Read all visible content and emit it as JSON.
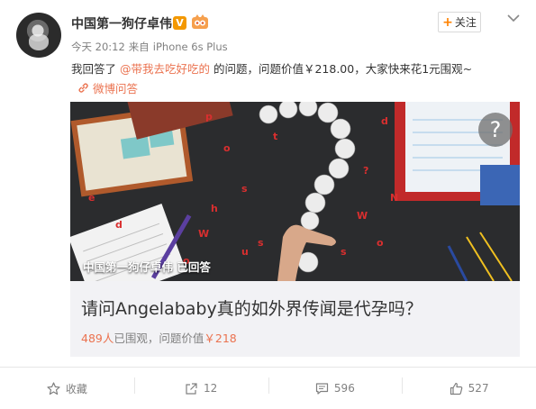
{
  "user": {
    "name": "中国第一狗仔卓伟",
    "vip_badge": "V",
    "follow_label": "关注"
  },
  "post": {
    "time": "今天 20:12",
    "source_prefix": "来自",
    "source": "iPhone 6s Plus",
    "text_before": "我回答了 ",
    "mention": "@带我去吃好吃的",
    "text_after": " 的问题，问题价值￥218.00，大家快来花1元围观~",
    "qa_link": "微博问答"
  },
  "card": {
    "image_caption": "中国第一狗仔卓伟 已回答",
    "help_symbol": "?",
    "question": "请问Angelababy真的如外界传闻是代孕吗？",
    "viewers": "489人",
    "viewers_suffix": "已围观，问题价值",
    "value": "￥218"
  },
  "actions": [
    {
      "icon": "star-icon",
      "label": "收藏"
    },
    {
      "icon": "share-icon",
      "label": "12"
    },
    {
      "icon": "comment-icon",
      "label": "596"
    },
    {
      "icon": "like-icon",
      "label": "527"
    }
  ],
  "colors": {
    "accent": "#eb7350",
    "follow_plus": "#ff8200",
    "vip": "#f39800",
    "muted": "#808080"
  }
}
